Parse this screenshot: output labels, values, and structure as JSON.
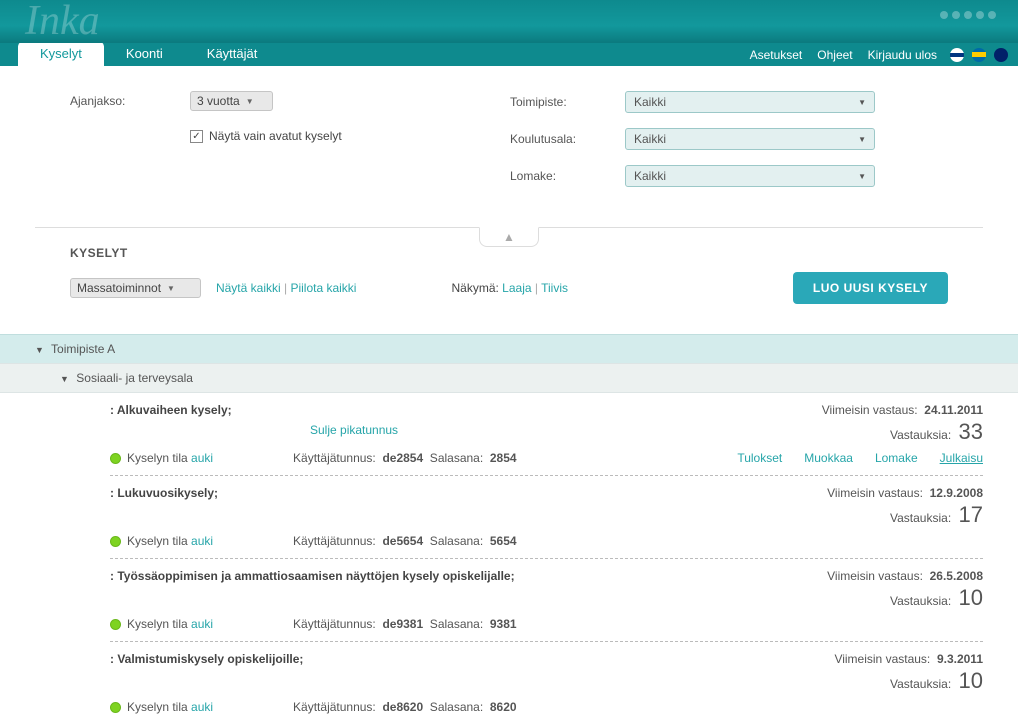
{
  "logo": "Inka",
  "tabs": {
    "kyselyt": "Kyselyt",
    "koonti": "Koonti",
    "kayttajat": "Käyttäjät"
  },
  "nav": {
    "asetukset": "Asetukset",
    "ohjeet": "Ohjeet",
    "logout": "Kirjaudu ulos"
  },
  "filters": {
    "ajanjakso_label": "Ajanjakso:",
    "ajanjakso_value": "3 vuotta",
    "checkbox_label": "Näytä vain avatut kyselyt",
    "toimipiste_label": "Toimipiste:",
    "toimipiste_value": "Kaikki",
    "koulutusala_label": "Koulutusala:",
    "koulutusala_value": "Kaikki",
    "lomake_label": "Lomake:",
    "lomake_value": "Kaikki"
  },
  "section": {
    "title": "KYSELYT",
    "massatoiminnot": "Massatoiminnot",
    "nayta_kaikki": "Näytä kaikki",
    "piilota_kaikki": "Piilota kaikki",
    "nakyma": "Näkymä:",
    "laaja": "Laaja",
    "tiivis": "Tiivis",
    "luo_uusi": "LUO UUSI KYSELY"
  },
  "groups": {
    "g1": "Toimipiste A",
    "g2": "Sosiaali- ja terveysala"
  },
  "labels": {
    "viimeisin": "Viimeisin vastaus:",
    "vastauksia": "Vastauksia:",
    "tila": "Kyselyn tila",
    "auki": "auki",
    "kayttaja": "Käyttäjätunnus:",
    "salasana": "Salasana:",
    "sulje": "Sulje pikatunnus",
    "tulokset": "Tulokset",
    "muokkaa": "Muokkaa",
    "lomake": "Lomake",
    "julkaisu": "Julkaisu"
  },
  "surveys": [
    {
      "title": ": Alkuvaiheen kysely;",
      "date": "24.11.2011",
      "count": "33",
      "user": "de2854",
      "pass": "2854",
      "showClose": true,
      "showActions": true
    },
    {
      "title": ": Lukuvuosikysely;",
      "date": "12.9.2008",
      "count": "17",
      "user": "de5654",
      "pass": "5654",
      "showClose": false,
      "showActions": false
    },
    {
      "title": ": Työssäoppimisen ja ammattiosaamisen näyttöjen kysely opiskelijalle;",
      "date": "26.5.2008",
      "count": "10",
      "user": "de9381",
      "pass": "9381",
      "showClose": false,
      "showActions": false
    },
    {
      "title": ": Valmistumiskysely opiskelijoille;",
      "date": "9.3.2011",
      "count": "10",
      "user": "de8620",
      "pass": "8620",
      "showClose": false,
      "showActions": false
    }
  ]
}
